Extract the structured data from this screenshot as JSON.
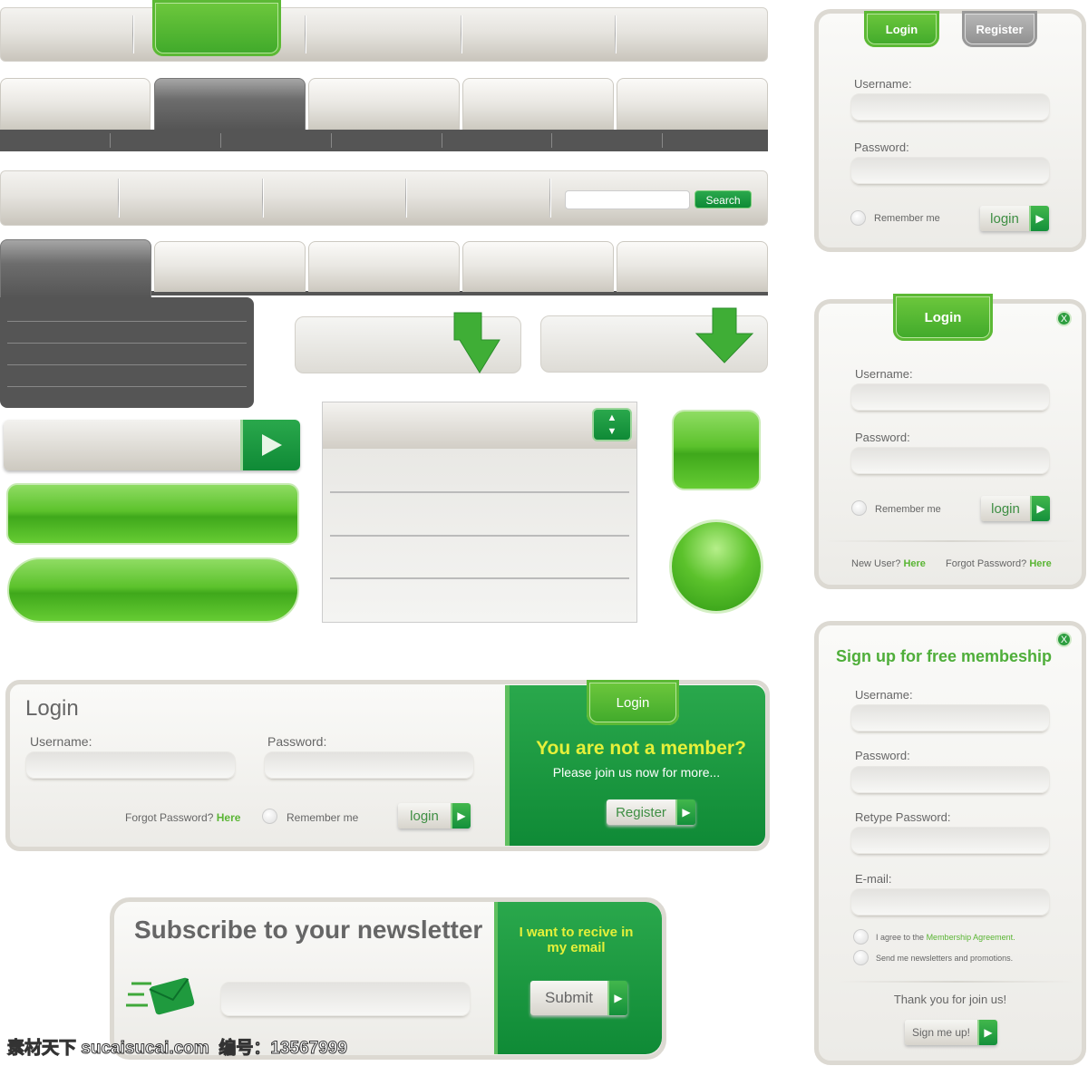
{
  "colors": {
    "accent": "#3fa81b",
    "dark_green": "#0f8a36",
    "link_green": "#5ab534",
    "yellow_text": "#e5f03a"
  },
  "navbar3": {
    "search_placeholder": "",
    "search_button": "Search"
  },
  "login_horizontal": {
    "title": "Login",
    "username_label": "Username:",
    "password_label": "Password:",
    "forgot_text": "Forgot Password?",
    "forgot_link": "Here",
    "remember": "Remember me",
    "login_button": "login",
    "ribbon": "Login",
    "headline": "You are not a member?",
    "subtext": "Please join us now for more...",
    "register_button": "Register"
  },
  "newsletter": {
    "title": "Subscribe to your newsletter",
    "side_text": "I want to recive in my email",
    "submit_button": "Submit",
    "email_icon": "envelope-icon"
  },
  "panel1": {
    "tab_login": "Login",
    "tab_register": "Register",
    "username_label": "Username:",
    "password_label": "Password:",
    "remember": "Remember me",
    "login_button": "login"
  },
  "panel2": {
    "ribbon": "Login",
    "close": "X",
    "username_label": "Username:",
    "password_label": "Password:",
    "remember": "Remember me",
    "login_button": "login",
    "new_user": "New User?",
    "new_user_link": "Here",
    "forgot": "Forgot Password?",
    "forgot_link": "Here"
  },
  "panel3": {
    "close": "X",
    "title": "Sign up for free membeship",
    "username_label": "Username:",
    "password_label": "Password:",
    "retype_label": "Retype Password:",
    "email_label": "E-mail:",
    "agree_text": "I agree to the",
    "agree_link": "Membership Agreement.",
    "newsletter_opt": "Send me newsletters and promotions.",
    "thanks": "Thank you for join us!",
    "signup_button": "Sign me up!"
  },
  "watermark": "素材天下 sucaisucai.com  编号：13567999"
}
